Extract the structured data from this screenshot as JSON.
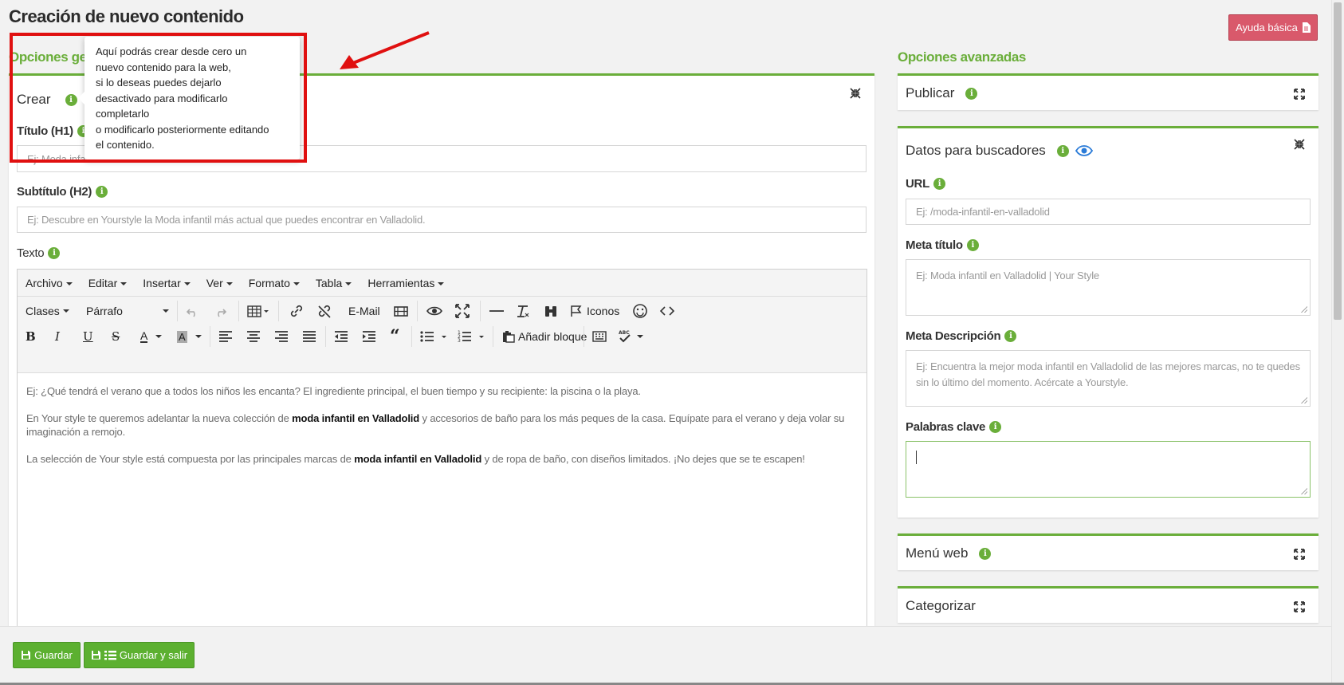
{
  "page": {
    "title": "Creación de nuevo contenido",
    "help_button": "Ayuda básica"
  },
  "general": {
    "section_title": "Opciones generales",
    "panel_title": "Crear",
    "title_label": "Título (H1)",
    "title_placeholder": "Ej: Moda infantil en Valladolid",
    "subtitle_label": "Subtítulo (H2)",
    "subtitle_placeholder": "Ej: Descubre en Yourstyle la Moda infantil más actual que puedes encontrar en Valladolid.",
    "text_label": "Texto"
  },
  "editor": {
    "menus": [
      "Archivo",
      "Editar",
      "Insertar",
      "Ver",
      "Formato",
      "Tabla",
      "Herramientas"
    ],
    "classes_label": "Clases",
    "format_label": "Párrafo",
    "email_label": "E-Mail",
    "icons_label": "Iconos",
    "add_block_label": "Añadir bloque",
    "spellcheck_label": "ABC",
    "paragraphs": [
      {
        "parts": [
          "Ej: ¿Qué tendrá el verano que a todos los niños les encanta? El ingrediente principal, el buen tiempo y su recipiente: la piscina o la playa."
        ]
      },
      {
        "before": "En Your style te queremos adelantar la nueva colección de ",
        "bold": "moda infantil en Valladolid",
        "after": " y accesorios de baño para los más peques de la casa. Equípate para el verano y deja volar su imaginación a remojo."
      },
      {
        "before": "La selección de Your style está compuesta por las principales marcas de ",
        "bold": "moda infantil en Valladolid",
        "after": " y de ropa de baño, con diseños limitados. ¡No dejes que se te escapen!"
      }
    ]
  },
  "tooltip": {
    "lines": [
      "Aquí podrás crear desde cero un",
      "nuevo contenido para la web,",
      "si lo deseas puedes dejarlo",
      "desactivado para modificarlo",
      "completarlo",
      "o modificarlo posteriormente editando",
      "el contenido."
    ]
  },
  "advanced": {
    "section_title": "Opciones avanzadas",
    "publish_title": "Publicar",
    "seo_title": "Datos para buscadores",
    "url_label": "URL",
    "url_placeholder": "Ej: /moda-infantil-en-valladolid",
    "meta_title_label": "Meta título",
    "meta_title_placeholder": "Ej: Moda infantil en Valladolid | Your Style",
    "meta_desc_label": "Meta Descripción",
    "meta_desc_placeholder": "Ej: Encuentra la mejor moda infantil en Valladolid de las mejores marcas, no te quedes sin lo último del momento. Acércate a Yourstyle.",
    "keywords_label": "Palabras clave",
    "keywords_value": "",
    "menu_title": "Menú web",
    "categorize_title": "Categorizar"
  },
  "footer": {
    "save": "Guardar",
    "save_exit": "Guardar y salir"
  },
  "colors": {
    "accent_green": "#6aae3a",
    "help_red": "#d9596b",
    "annotation_red": "#e01010",
    "eye_blue": "#2a7bd8"
  }
}
